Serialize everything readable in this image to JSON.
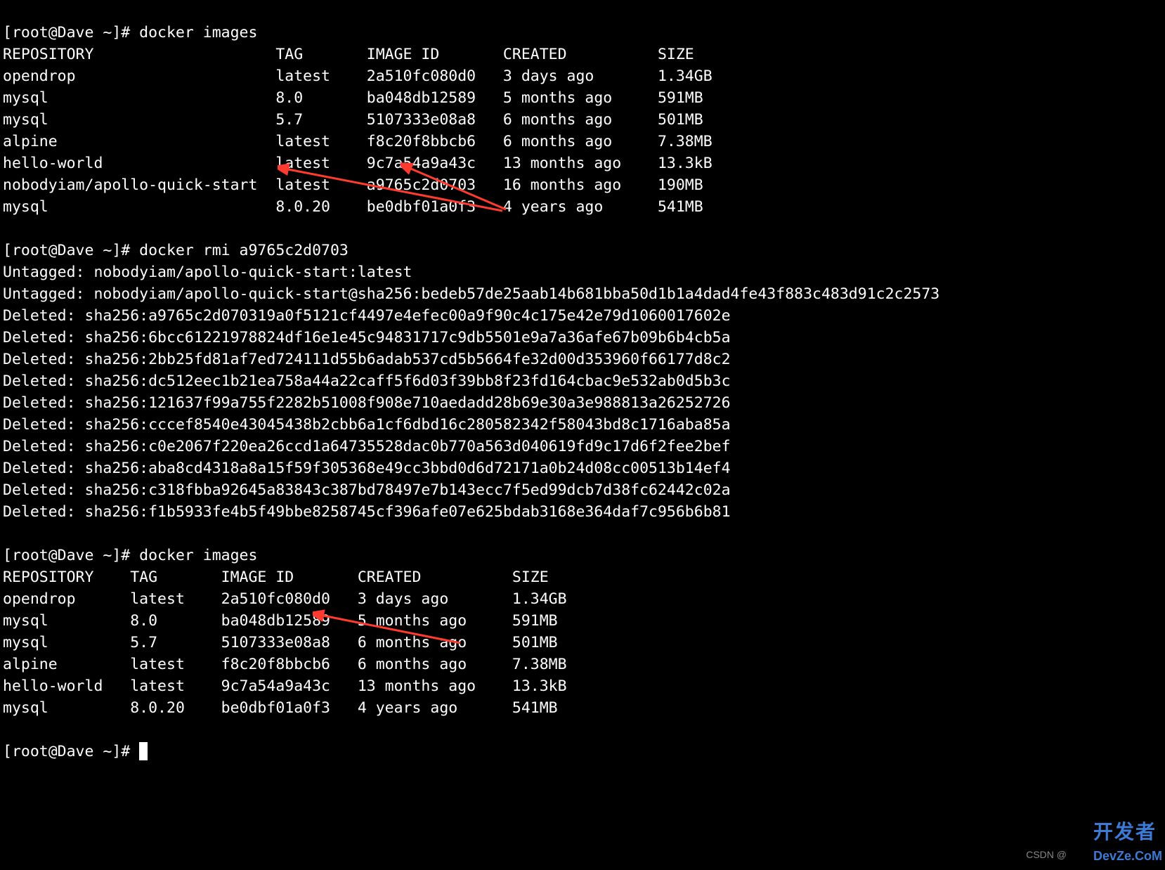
{
  "prompt1": "[root@Dave ~]# docker images",
  "table1": {
    "header": [
      "REPOSITORY",
      "TAG",
      "IMAGE ID",
      "CREATED",
      "SIZE"
    ],
    "cols": [
      30,
      10,
      15,
      17,
      8
    ],
    "rows": [
      [
        "opendrop",
        "latest",
        "2a510fc080d0",
        "3 days ago",
        "1.34GB"
      ],
      [
        "mysql",
        "8.0",
        "ba048db12589",
        "5 months ago",
        "591MB"
      ],
      [
        "mysql",
        "5.7",
        "5107333e08a8",
        "6 months ago",
        "501MB"
      ],
      [
        "alpine",
        "latest",
        "f8c20f8bbcb6",
        "6 months ago",
        "7.38MB"
      ],
      [
        "hello-world",
        "latest",
        "9c7a54a9a43c",
        "13 months ago",
        "13.3kB"
      ],
      [
        "nobodyiam/apollo-quick-start",
        "latest",
        "a9765c2d0703",
        "16 months ago",
        "190MB"
      ],
      [
        "mysql",
        "8.0.20",
        "be0dbf01a0f3",
        "4 years ago",
        "541MB"
      ]
    ]
  },
  "prompt2": "[root@Dave ~]# docker rmi a9765c2d0703",
  "output": [
    "Untagged: nobodyiam/apollo-quick-start:latest",
    "Untagged: nobodyiam/apollo-quick-start@sha256:bedeb57de25aab14b681bba50d1b1a4dad4fe43f883c483d91c2c2573",
    "Deleted: sha256:a9765c2d070319a0f5121cf4497e4efec00a9f90c4c175e42e79d1060017602e",
    "Deleted: sha256:6bcc61221978824df16e1e45c94831717c9db5501e9a7a36afe67b09b6b4cb5a",
    "Deleted: sha256:2bb25fd81af7ed724111d55b6adab537cd5b5664fe32d00d353960f66177d8c2",
    "Deleted: sha256:dc512eec1b21ea758a44a22caff5f6d03f39bb8f23fd164cbac9e532ab0d5b3c",
    "Deleted: sha256:121637f99a755f2282b51008f908e710aedadd28b69e30a3e988813a26252726",
    "Deleted: sha256:cccef8540e43045438b2cbb6a1cf6dbd16c280582342f58043bd8c1716aba85a",
    "Deleted: sha256:c0e2067f220ea26ccd1a64735528dac0b770a563d040619fd9c17d6f2fee2bef",
    "Deleted: sha256:aba8cd4318a8a15f59f305368e49cc3bbd0d6d72171a0b24d08cc00513b14ef4",
    "Deleted: sha256:c318fbba92645a83843c387bd78497e7b143ecc7f5ed99dcb7d38fc62442c02a",
    "Deleted: sha256:f1b5933fe4b5f49bbe8258745cf396afe07e625bdab3168e364daf7c956b6b81"
  ],
  "prompt3": "[root@Dave ~]# docker images",
  "table2": {
    "header": [
      "REPOSITORY",
      "TAG",
      "IMAGE ID",
      "CREATED",
      "SIZE"
    ],
    "cols": [
      14,
      10,
      15,
      17,
      8
    ],
    "rows": [
      [
        "opendrop",
        "latest",
        "2a510fc080d0",
        "3 days ago",
        "1.34GB"
      ],
      [
        "mysql",
        "8.0",
        "ba048db12589",
        "5 months ago",
        "591MB"
      ],
      [
        "mysql",
        "5.7",
        "5107333e08a8",
        "6 months ago",
        "501MB"
      ],
      [
        "alpine",
        "latest",
        "f8c20f8bbcb6",
        "6 months ago",
        "7.38MB"
      ],
      [
        "hello-world",
        "latest",
        "9c7a54a9a43c",
        "13 months ago",
        "13.3kB"
      ],
      [
        "mysql",
        "8.0.20",
        "be0dbf01a0f3",
        "4 years ago",
        "541MB"
      ]
    ]
  },
  "prompt4": "[root@Dave ~]# ",
  "watermark_cn": "开发者",
  "watermark_sub": "DevZe.CoM",
  "csdn": "CSDN @"
}
